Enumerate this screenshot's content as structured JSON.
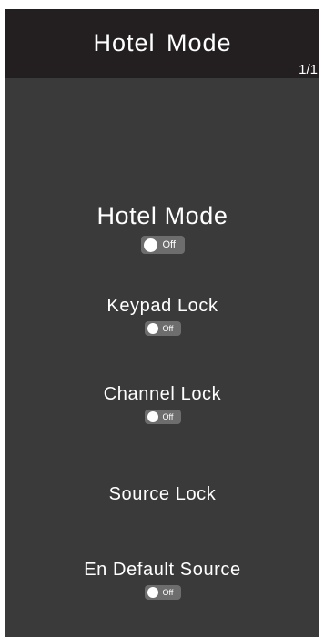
{
  "header": {
    "title": "Hotel Mode",
    "page_indicator": "1/1"
  },
  "items": [
    {
      "label": "Hotel Mode",
      "toggle": "Off"
    },
    {
      "label": "Keypad Lock",
      "toggle": "Off"
    },
    {
      "label": "Channel Lock",
      "toggle": "Off"
    },
    {
      "label": "Source Lock"
    },
    {
      "label": "En Default Source",
      "toggle": "Off"
    }
  ],
  "colors": {
    "screen_bg": "#3a3a3a",
    "header_bg": "#231f20",
    "toggle_bg": "#6d6d6d",
    "text": "#ffffff"
  }
}
